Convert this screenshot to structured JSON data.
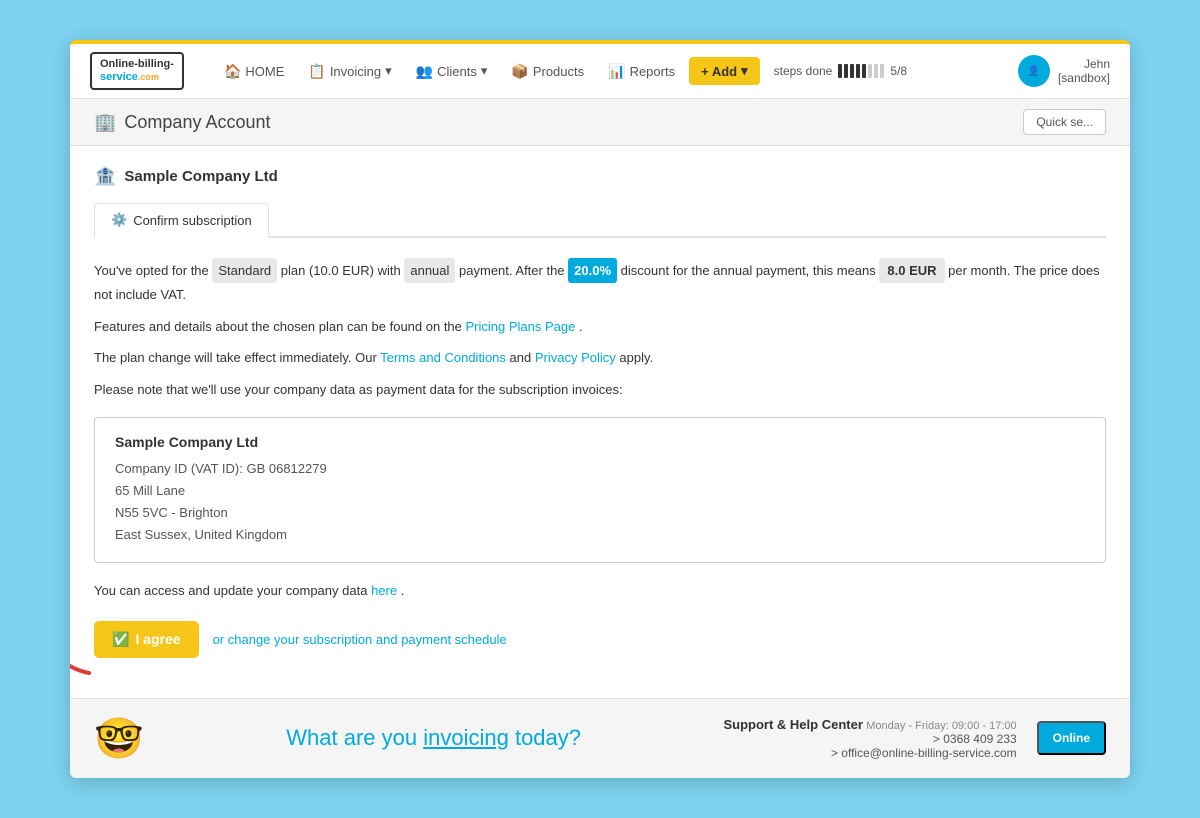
{
  "app": {
    "title": "Online-billing-service.com"
  },
  "logo": {
    "line1": "Online-billing-",
    "line2": "service",
    "com": ".com"
  },
  "navbar": {
    "home": "HOME",
    "invoicing": "Invoicing",
    "clients": "Clients",
    "products": "Products",
    "reports": "Reports",
    "add": "+ Add",
    "steps_label": "steps done",
    "steps_count": "5/8",
    "user_name": "Jehn",
    "user_subtitle": "[sandbox]"
  },
  "page": {
    "title": "Company Account",
    "quick_search": "Quick se..."
  },
  "company": {
    "name": "Sample Company Ltd"
  },
  "tab": {
    "label": "Confirm subscription"
  },
  "content": {
    "line1_pre": "You've opted for the",
    "plan": "Standard",
    "line1_mid1": "plan (10.0 EUR) with",
    "payment_type": "annual",
    "line1_mid2": "payment. After the",
    "discount": "20.0%",
    "line1_mid3": "discount for the annual payment, this means",
    "price": "8.0 EUR",
    "line1_post": "per month. The price does not include VAT.",
    "line2_pre": "Features and details about the chosen plan can be found on the",
    "pricing_link": "Pricing Plans Page",
    "line2_post": ".",
    "line3_pre": "The plan change will take effect immediately. Our",
    "terms_link": "Terms and Conditions",
    "line3_mid": "and",
    "privacy_link": "Privacy Policy",
    "line3_post": "apply.",
    "line4": "Please note that we'll use your company data as payment data for the subscription invoices:",
    "company_card": {
      "name": "Sample Company Ltd",
      "vat": "Company ID (VAT ID): GB 06812279",
      "address1": "65 Mill Lane",
      "address2": "N55 5VC - Brighton",
      "address3": "East Sussex, United Kingdom"
    },
    "access_pre": "You can access and update your company data",
    "access_link": "here",
    "access_post": ".",
    "agree_btn": "I agree",
    "change_link": "or change your subscription and payment schedule"
  },
  "footer": {
    "tagline_pre": "What are you ",
    "tagline_highlight": "invoicing",
    "tagline_post": " today?",
    "support_title": "Support & Help Center",
    "support_hours": "Monday - Friday: 09:00 - 17:00",
    "phone": "> 0368 409 233",
    "email": "> office@online-billing-service.com",
    "online_btn": "Online"
  },
  "colors": {
    "accent": "#00aadd",
    "yellow": "#f5c518",
    "red": "#e53935",
    "highlight_gray": "#e8e8e8"
  }
}
